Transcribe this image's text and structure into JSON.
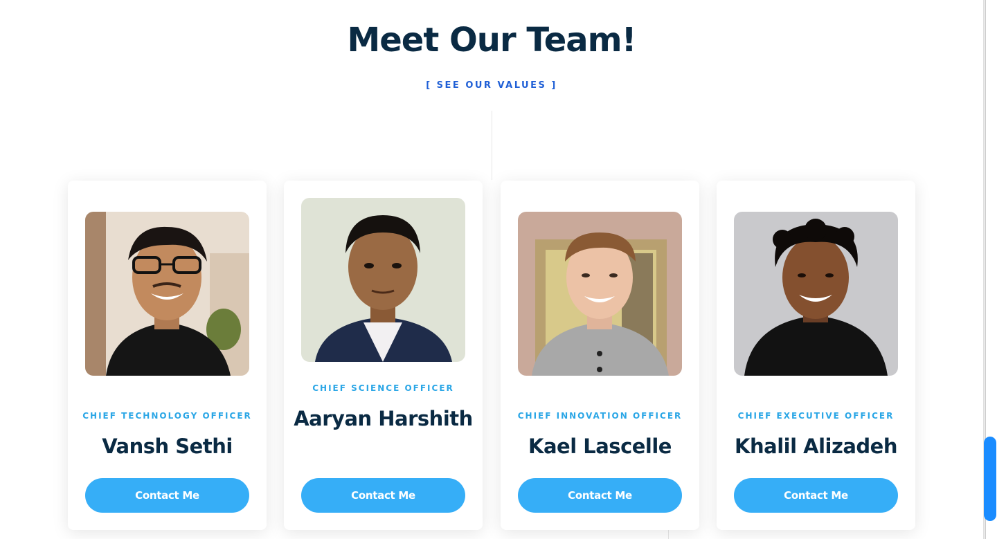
{
  "header": {
    "title": "Meet Our Team!",
    "values_link": "[ SEE OUR VALUES ]"
  },
  "team": [
    {
      "role": "CHIEF TECHNOLOGY OFFICER",
      "name": "Vansh Sethi",
      "button": "Contact Me"
    },
    {
      "role": "CHIEF SCIENCE OFFICER",
      "name": "Aaryan Harshith",
      "button": "Contact Me"
    },
    {
      "role": "CHIEF INNOVATION OFFICER",
      "name": "Kael Lascelle",
      "button": "Contact Me"
    },
    {
      "role": "CHIEF EXECUTIVE OFFICER",
      "name": "Khalil Alizadeh",
      "button": "Contact Me"
    }
  ],
  "colors": {
    "title": "#0a2a43",
    "link": "#1f5fd6",
    "role": "#2aa6e6",
    "button": "#36aef7",
    "scrollbar": "#1a8cff"
  }
}
